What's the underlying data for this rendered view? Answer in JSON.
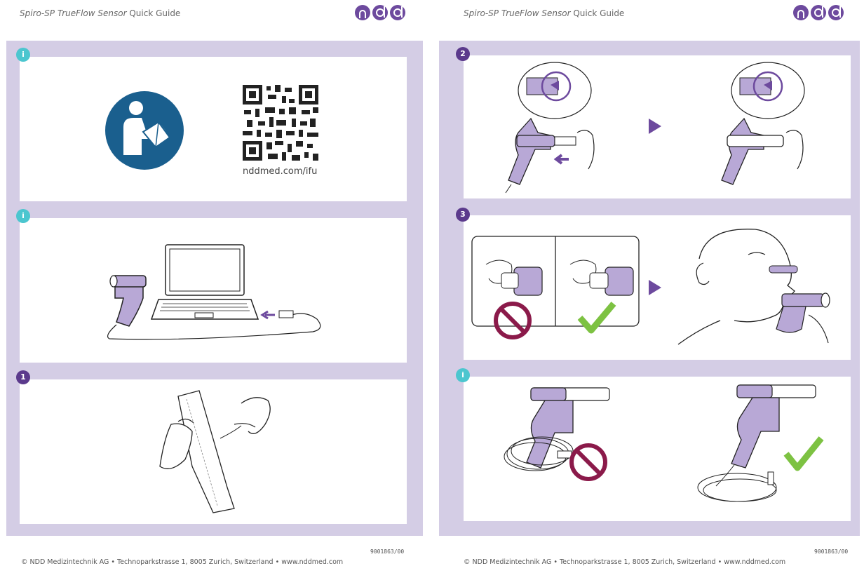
{
  "header": {
    "title_italic": "Spiro-SP TrueFlow Sensor",
    "title_rest": " Quick Guide",
    "logo_alt": "ndd",
    "logo_icon": "ndd-logo"
  },
  "left_page": {
    "panels": [
      {
        "badge": "i",
        "type": "info",
        "qr_url": "nddmed.com/ifu"
      },
      {
        "badge": "i",
        "type": "info"
      },
      {
        "badge": "1",
        "type": "step"
      }
    ],
    "doc_code": "9001863/00",
    "footer": "© NDD Medizintechnik AG • Technoparkstrasse 1, 8005 Zurich, Switzerland • www.nddmed.com"
  },
  "right_page": {
    "panels": [
      {
        "badge": "2",
        "type": "step"
      },
      {
        "badge": "3",
        "type": "step"
      },
      {
        "badge": "i",
        "type": "info"
      }
    ],
    "doc_code": "9001863/00",
    "footer": "© NDD Medizintechnik AG • Technoparkstrasse 1, 8005 Zurich, Switzerland • www.nddmed.com"
  },
  "colors": {
    "frame": "#d4cde5",
    "purple": "#6d4a9e",
    "info_badge": "#4cc6cf",
    "step_badge": "#5b3a8c",
    "no_sign": "#8b1a4a",
    "check": "#7dc242",
    "manual_icon": "#1a5f8e",
    "device": "#b8a8d6"
  }
}
